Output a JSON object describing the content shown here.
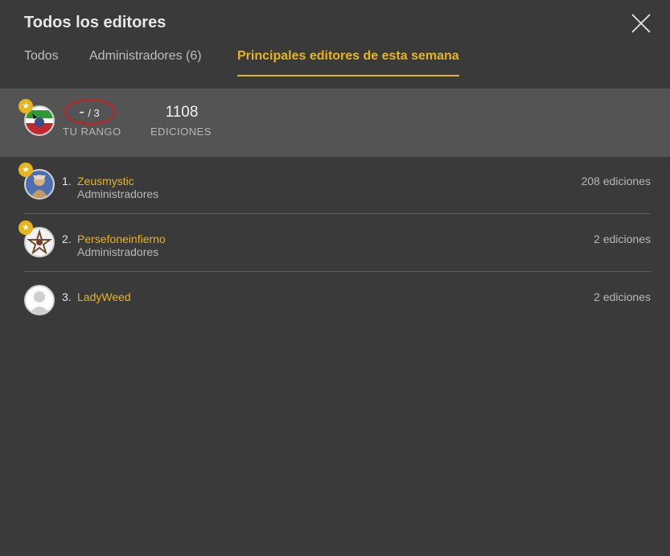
{
  "modal": {
    "title": "Todos los editores",
    "close_icon": "close-icon"
  },
  "tabs": [
    {
      "label": "Todos",
      "active": false
    },
    {
      "label": "Administradores (6)",
      "active": false
    },
    {
      "label": "Principales editores de esta semana",
      "active": true
    }
  ],
  "my_stats": {
    "rank_dash": "-",
    "rank_total": "/ 3",
    "rank_label": "TU RANGO",
    "edits_value": "1108",
    "edits_label": "EDICIONES",
    "avatar_icon": "user-avatar",
    "badge_icon": "star-badge-icon"
  },
  "editors": [
    {
      "rank": "1.",
      "name": "Zeusmystic",
      "role": "Administradores",
      "edits": "208 ediciones",
      "admin_badge": true
    },
    {
      "rank": "2.",
      "name": "Persefoneinfierno",
      "role": "Administradores",
      "edits": "2 ediciones",
      "admin_badge": true
    },
    {
      "rank": "3.",
      "name": "LadyWeed",
      "role": "",
      "edits": "2 ediciones",
      "admin_badge": false
    }
  ],
  "colors": {
    "accent": "#e7b51c",
    "background": "#3a3a3a",
    "stats_band": "#545454",
    "highlight_circle": "#c81e1e"
  }
}
